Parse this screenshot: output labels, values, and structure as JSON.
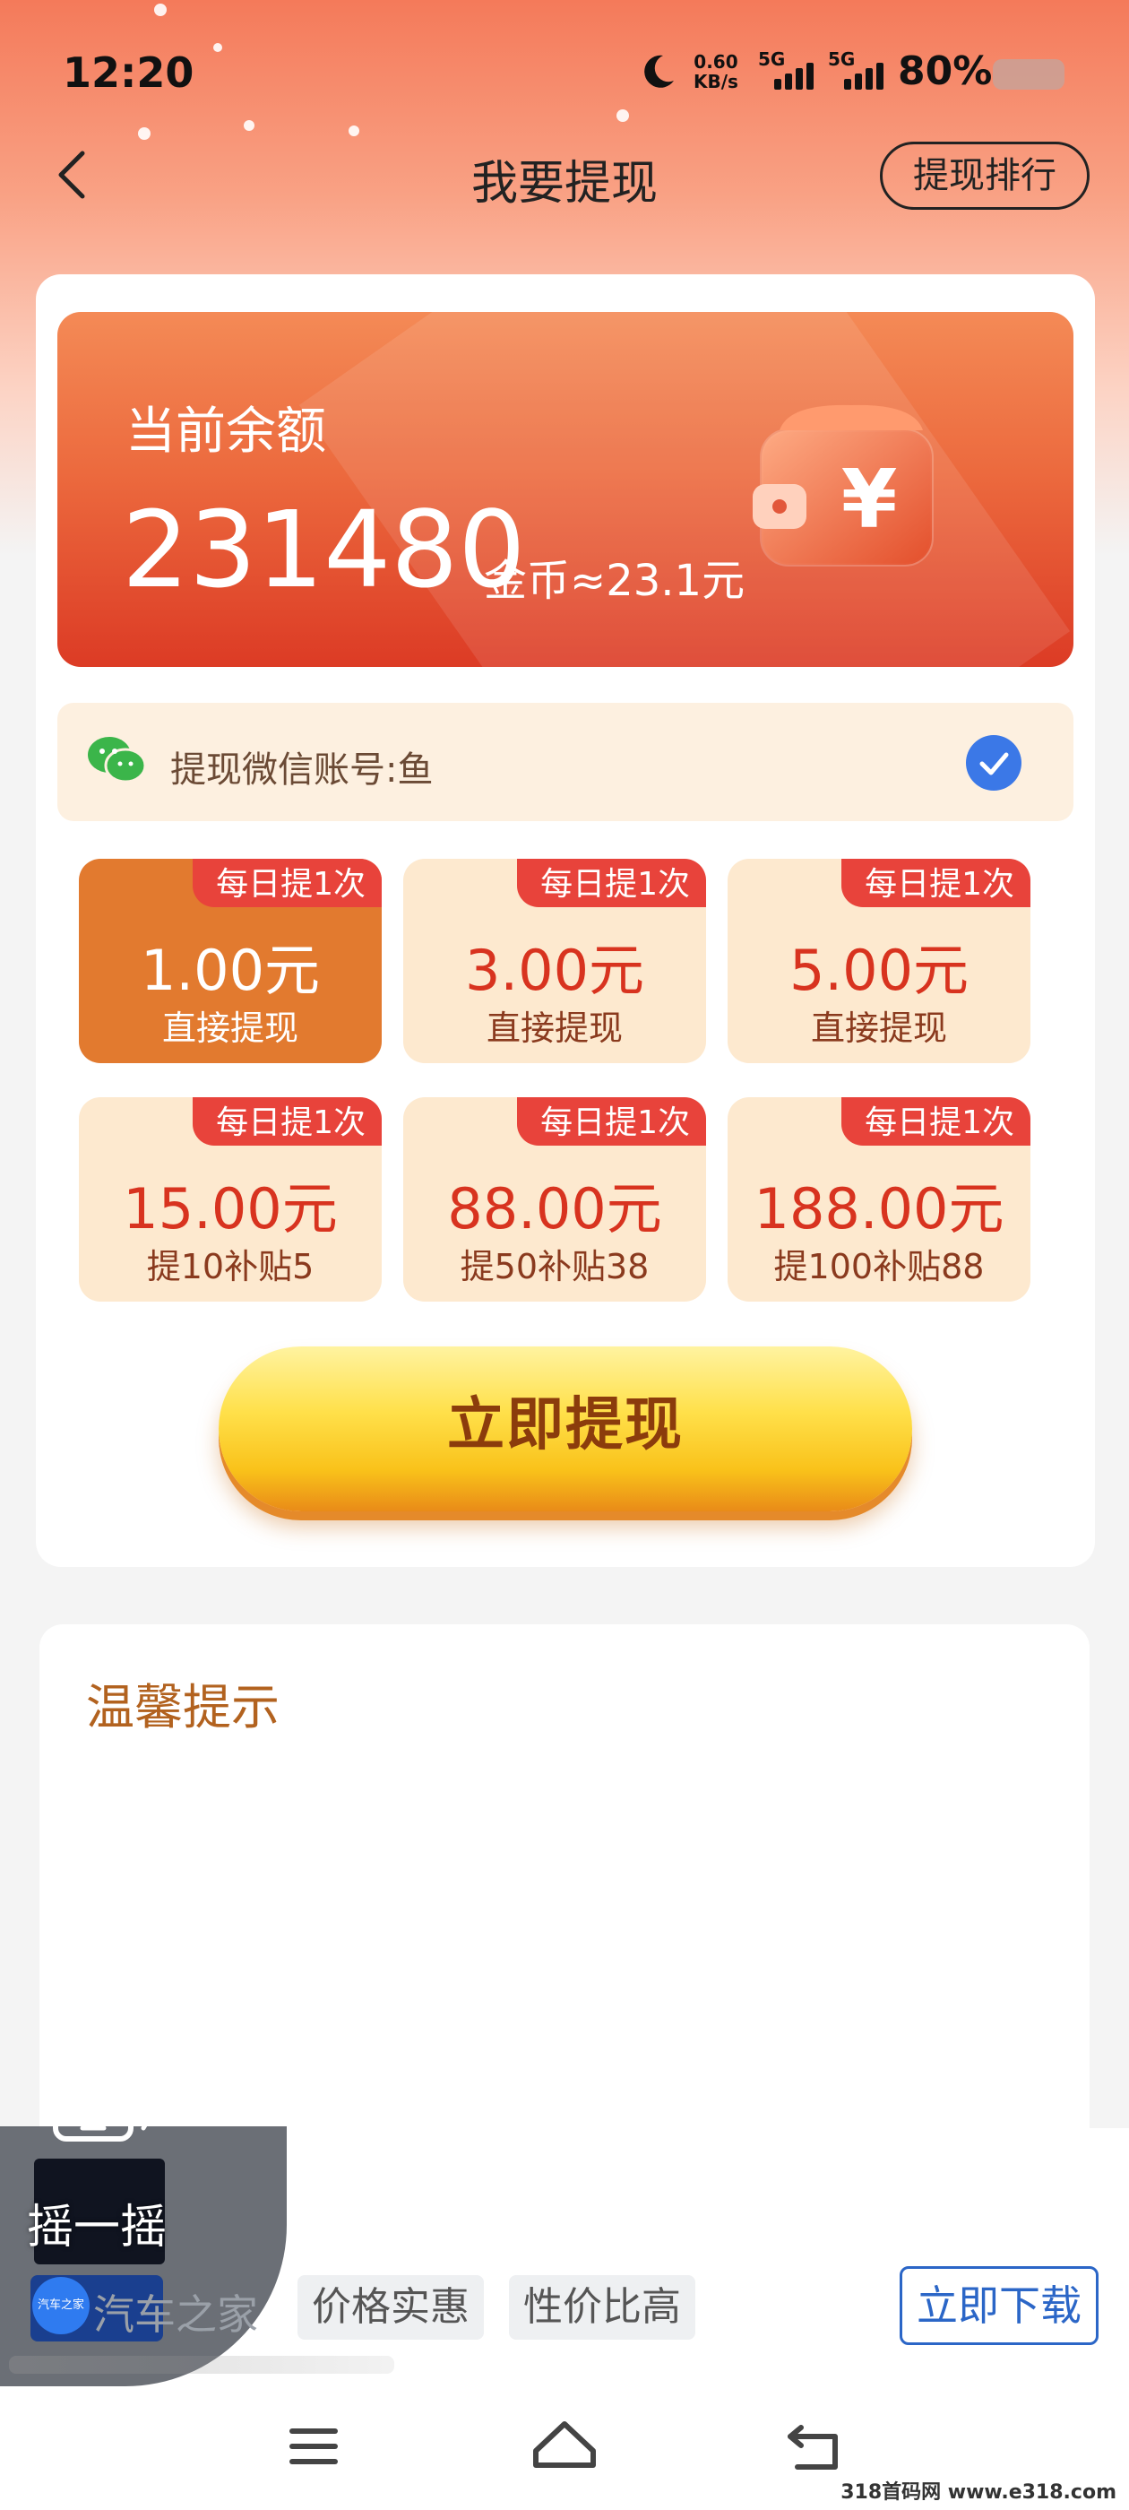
{
  "status_bar": {
    "time": "12:20",
    "net_speed_value": "0.60",
    "net_speed_unit": "KB/s",
    "signal_1_label": "5G",
    "signal_2_label": "5G",
    "battery_percent": "80%"
  },
  "header": {
    "title": "我要提现",
    "rank_button": "提现排行"
  },
  "balance": {
    "label": "当前余额",
    "amount": "231480",
    "unit_text": "金币≈23.1元"
  },
  "account": {
    "text": "提现微信账号:鱼",
    "selected": true
  },
  "options": [
    {
      "tag": "每日提1次",
      "amount": "1.00元",
      "desc": "直接提现",
      "selected": true
    },
    {
      "tag": "每日提1次",
      "amount": "3.00元",
      "desc": "直接提现",
      "selected": false
    },
    {
      "tag": "每日提1次",
      "amount": "5.00元",
      "desc": "直接提现",
      "selected": false
    },
    {
      "tag": "每日提1次",
      "amount": "15.00元",
      "desc": "提10补贴5",
      "selected": false
    },
    {
      "tag": "每日提1次",
      "amount": "88.00元",
      "desc": "提50补贴38",
      "selected": false
    },
    {
      "tag": "每日提1次",
      "amount": "188.00元",
      "desc": "提100补贴88",
      "selected": false
    }
  ],
  "withdraw_button": "立即提现",
  "tips": {
    "title": "温馨提示"
  },
  "ad": {
    "shake_label": "摇一摇",
    "logo_text": "汽车之家",
    "brand": "汽车之家",
    "tags": [
      "价格实惠",
      "性价比高"
    ],
    "download_button": "立即下载"
  },
  "watermark": "318首码网 www.e318.com",
  "colors": {
    "accent_orange": "#e27a2f",
    "tag_red": "#e8433b",
    "amount_red": "#d8331f",
    "button_yellow": "#ffe04a",
    "check_blue": "#3b78e7",
    "wechat_green": "#3bb54a"
  }
}
